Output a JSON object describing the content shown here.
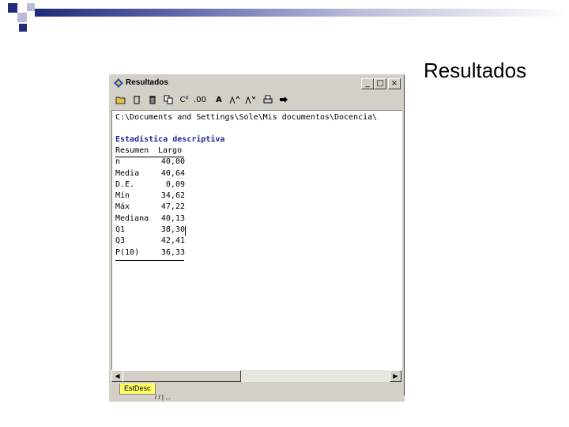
{
  "slide": {
    "title": "Resultados",
    "accent_dark": "#1f2a7a",
    "accent_light": "#b9bcd9"
  },
  "window": {
    "title": "Resultados",
    "controls": {
      "minimize": "_",
      "maximize": "□",
      "close": "×"
    },
    "toolbar_icons": [
      "open-folder-icon",
      "delete-icon",
      "trash-icon",
      "copy-icon",
      "superscript-icon",
      "decimals-icon",
      "font-icon",
      "increase-font-icon",
      "decrease-font-icon",
      "print-icon",
      "pin-icon"
    ],
    "toolbar_labels": {
      "decimals_left": "C⁰",
      "decimals_right": ".00",
      "font": "A"
    },
    "path": "C:\\Documents and Settings\\Sole\\Mis documentos\\Docencia\\",
    "section_title": "Estadística descriptiva",
    "table": {
      "headers": [
        "Resumen",
        "Largo"
      ],
      "rows": [
        [
          "n",
          "40,00"
        ],
        [
          "Media",
          "40,64"
        ],
        [
          "D.E.",
          "0,09"
        ],
        [
          "Mín",
          "34,62"
        ],
        [
          "Máx",
          "47,22"
        ],
        [
          "Mediana",
          "40,13"
        ],
        [
          "Q1",
          "38,30"
        ],
        [
          "Q3",
          "42,41"
        ],
        [
          "P(10)",
          "36,33"
        ]
      ]
    },
    "sheet_tab": "EstDesc",
    "status_text": "/ / | ..."
  }
}
